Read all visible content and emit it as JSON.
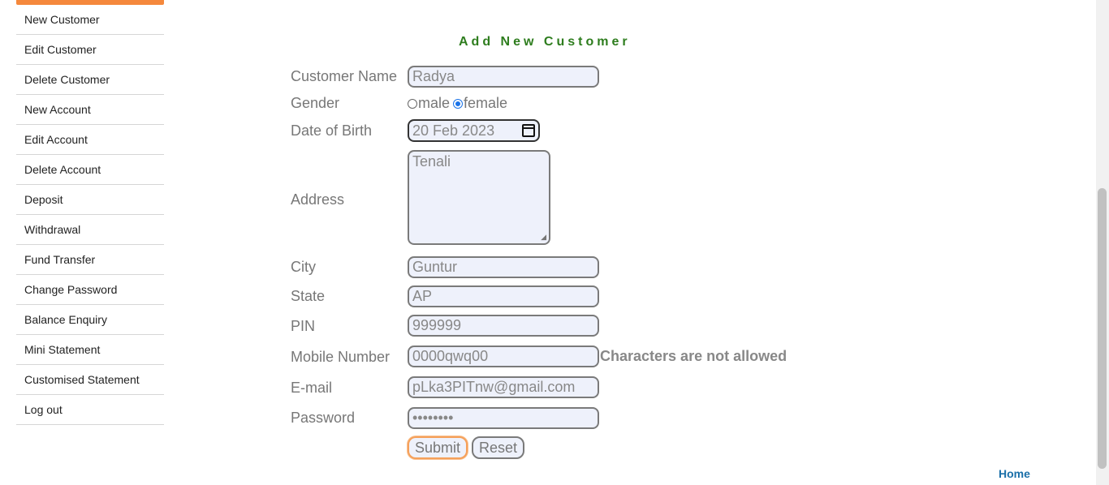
{
  "sidebar": {
    "items": [
      {
        "label": "New Customer"
      },
      {
        "label": "Edit Customer"
      },
      {
        "label": "Delete Customer"
      },
      {
        "label": "New Account"
      },
      {
        "label": "Edit Account"
      },
      {
        "label": "Delete Account"
      },
      {
        "label": "Deposit"
      },
      {
        "label": "Withdrawal"
      },
      {
        "label": "Fund Transfer"
      },
      {
        "label": "Change Password"
      },
      {
        "label": "Balance Enquiry"
      },
      {
        "label": "Mini Statement"
      },
      {
        "label": "Customised Statement"
      },
      {
        "label": "Log out"
      }
    ]
  },
  "form": {
    "title": "Add New Customer",
    "labels": {
      "customer_name": "Customer Name",
      "gender": "Gender",
      "dob": "Date of Birth",
      "address": "Address",
      "city": "City",
      "state": "State",
      "pin": "PIN",
      "mobile": "Mobile Number",
      "email": "E-mail",
      "password": "Password"
    },
    "values": {
      "customer_name": "Radya",
      "dob": "20 Feb 2023",
      "address": "Tenali",
      "city": "Guntur",
      "state": "AP",
      "pin": "999999",
      "mobile": "0000qwq00",
      "email": "pLka3PITnw@gmail.com",
      "password": "••••••••"
    },
    "gender_options": {
      "male": "male",
      "female": "female",
      "selected": "female"
    },
    "errors": {
      "mobile": "Characters are not allowed"
    },
    "buttons": {
      "submit": "Submit",
      "reset": "Reset"
    }
  },
  "footer": {
    "home_link": "Home"
  },
  "colors": {
    "accent": "#f5883c",
    "title_green": "#2e7d1e",
    "link_blue": "#1a6fa8"
  }
}
